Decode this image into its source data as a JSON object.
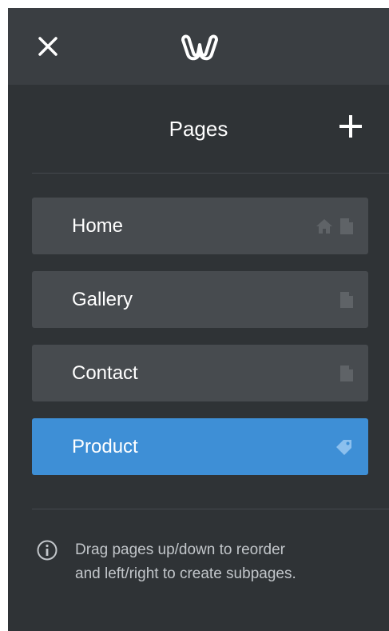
{
  "topbar": {
    "close_icon": "close-icon",
    "logo_icon": "weebly-logo-icon"
  },
  "panel": {
    "title": "Pages",
    "add_icon": "plus-icon"
  },
  "pages": [
    {
      "label": "Home",
      "icons": [
        "home-icon",
        "page-icon"
      ],
      "active": false
    },
    {
      "label": "Gallery",
      "icons": [
        "page-icon"
      ],
      "active": false
    },
    {
      "label": "Contact",
      "icons": [
        "page-icon"
      ],
      "active": false
    },
    {
      "label": "Product",
      "icons": [
        "tag-icon"
      ],
      "active": true
    }
  ],
  "hint": {
    "icon": "info-icon",
    "line1": "Drag pages up/down to reorder",
    "line2": "and left/right to create subpages."
  },
  "colors": {
    "panel_bg": "#2f3336",
    "topbar_bg": "#3a3e42",
    "item_bg": "#474b4f",
    "active_bg": "#3e8fd6",
    "icon_muted": "#5f6367"
  }
}
